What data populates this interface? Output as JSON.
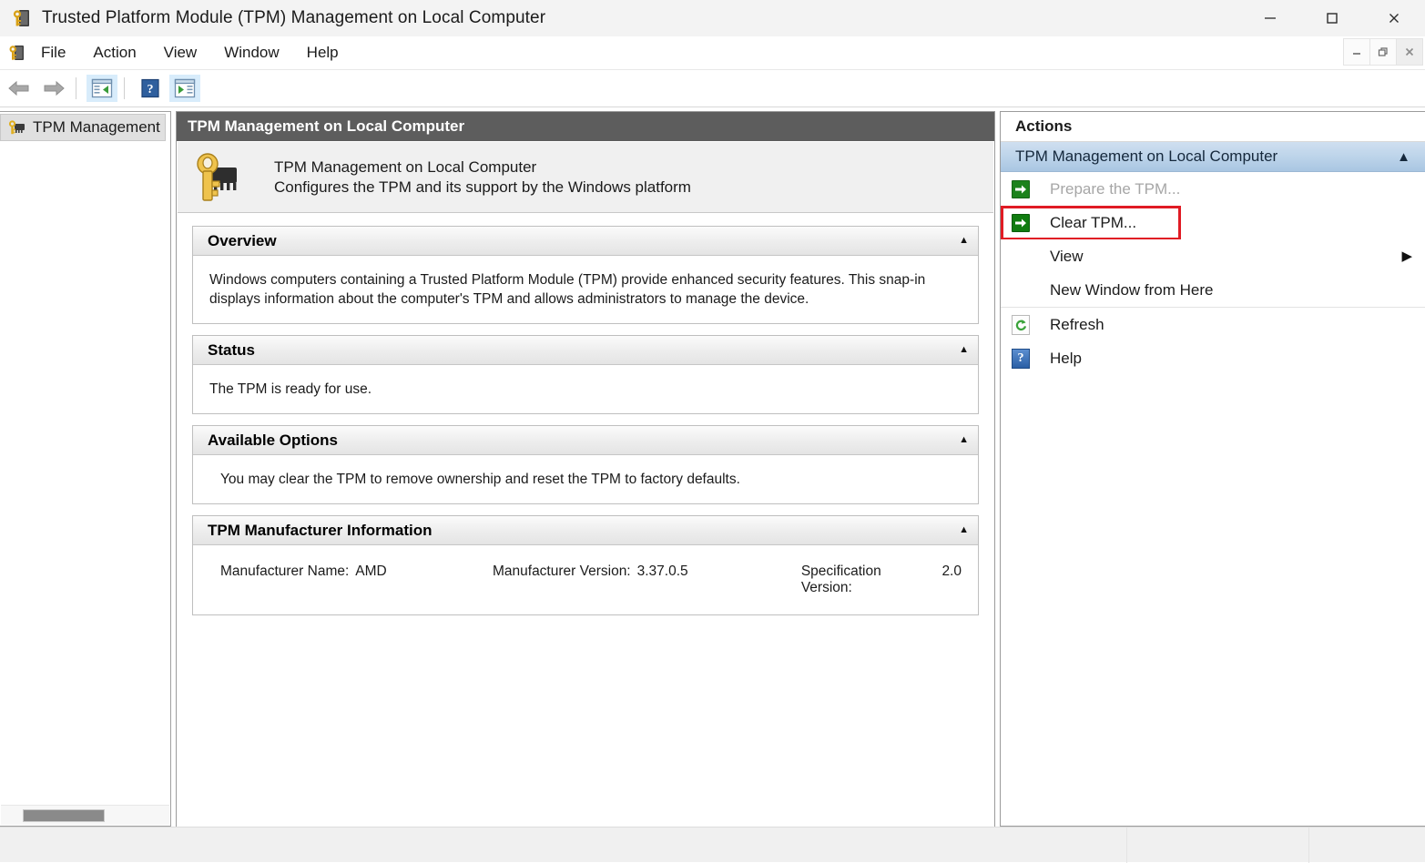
{
  "window": {
    "title": "Trusted Platform Module (TPM) Management on Local Computer",
    "icon": "tpm-key-chip-icon",
    "controls": {
      "minimize": "minimize-icon",
      "maximize": "maximize-icon",
      "close": "close-icon"
    },
    "mdi_controls": {
      "minimize": "mdi-minimize-icon",
      "restore": "mdi-restore-icon",
      "close": "mdi-close-icon"
    }
  },
  "menubar": {
    "icon": "tpm-key-chip-icon",
    "items": [
      {
        "label": "File"
      },
      {
        "label": "Action"
      },
      {
        "label": "View"
      },
      {
        "label": "Window"
      },
      {
        "label": "Help"
      }
    ]
  },
  "toolbar": {
    "buttons": [
      {
        "name": "back-icon",
        "icon": "back-arrow",
        "active": false
      },
      {
        "name": "forward-icon",
        "icon": "forward-arrow",
        "active": false
      },
      {
        "name": "show-hide-console-tree-icon",
        "icon": "console-tree",
        "active": true
      },
      {
        "name": "help-icon",
        "icon": "question-mark",
        "active": false
      },
      {
        "name": "show-hide-action-pane-icon",
        "icon": "action-pane",
        "active": true
      }
    ]
  },
  "tree": {
    "nodes": [
      {
        "label": "TPM Management",
        "icon": "tpm-key-chip-icon",
        "selected": true
      }
    ],
    "hscroll": "horizontal-scrollbar"
  },
  "center": {
    "header_title": "TPM Management on Local Computer",
    "banner": {
      "icon": "tpm-key-chip-large-icon",
      "line1": "TPM Management on Local Computer",
      "line2": "Configures the TPM and its support by the Windows platform"
    },
    "sections": [
      {
        "title": "Overview",
        "chevron": "chevron-up-icon",
        "body": "Windows computers containing a Trusted Platform Module (TPM) provide enhanced security features. This snap-in displays information about the computer's TPM and allows administrators to manage the device."
      },
      {
        "title": "Status",
        "chevron": "chevron-up-icon",
        "body": "The TPM is ready for use."
      },
      {
        "title": "Available Options",
        "chevron": "chevron-up-icon",
        "body": "You may clear the TPM to remove ownership and reset the TPM to factory defaults."
      }
    ],
    "manufacturer_section": {
      "title": "TPM Manufacturer Information",
      "chevron": "chevron-up-icon",
      "fields": [
        {
          "label": "Manufacturer Name:",
          "value": "AMD"
        },
        {
          "label": "Manufacturer Version:",
          "value": "3.37.0.5"
        },
        {
          "label": "Specification Version:",
          "value": "2.0"
        }
      ]
    }
  },
  "actions": {
    "header": "Actions",
    "group": {
      "title": "TPM Management on Local Computer",
      "chevron": "chevron-up-icon"
    },
    "items": [
      {
        "label": "Prepare the TPM...",
        "icon": "green-arrow-icon",
        "disabled": true,
        "highlighted": false
      },
      {
        "label": "Clear TPM...",
        "icon": "green-arrow-icon",
        "disabled": false,
        "highlighted": true
      },
      {
        "label": "View",
        "icon": null,
        "disabled": false,
        "highlighted": false,
        "submenu": "submenu-arrow-icon"
      },
      {
        "label": "New Window from Here",
        "icon": null,
        "disabled": false,
        "highlighted": false
      },
      {
        "label": "Refresh",
        "icon": "refresh-icon",
        "disabled": false,
        "highlighted": false
      },
      {
        "label": "Help",
        "icon": "help-icon",
        "disabled": false,
        "highlighted": false
      }
    ]
  },
  "colors": {
    "highlight_red": "#e01b24",
    "green_icon": "#107c10",
    "center_header_bg": "#5d5d5d",
    "actions_group_bg": "#bdd4ea"
  },
  "statusbar": {
    "panes": [
      "",
      "",
      ""
    ]
  }
}
